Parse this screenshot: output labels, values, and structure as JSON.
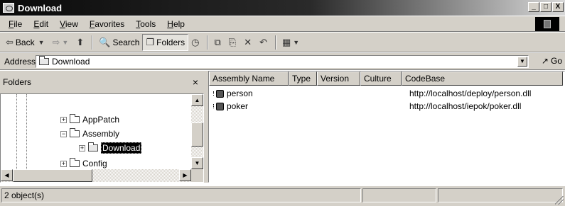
{
  "window": {
    "title": "Download",
    "buttons": [
      "_",
      "□",
      "X"
    ]
  },
  "menu": [
    "File",
    "Edit",
    "View",
    "Favorites",
    "Tools",
    "Help"
  ],
  "toolbar": {
    "back": "Back",
    "search": "Search",
    "folders": "Folders"
  },
  "address": {
    "label": "Address",
    "value": "Download",
    "go": "Go"
  },
  "folders_pane": {
    "header": "Folders",
    "close": "×",
    "tree": [
      {
        "label": "AppPatch",
        "expander": "+",
        "selected": false
      },
      {
        "label": "Assembly",
        "expander": "−",
        "selected": false
      },
      {
        "label": "Download",
        "expander": "+",
        "selected": true
      },
      {
        "label": "Config",
        "expander": "+",
        "selected": false
      }
    ]
  },
  "list": {
    "columns": [
      "Assembly Name",
      "Type",
      "Version",
      "Culture",
      "CodeBase"
    ],
    "rows": [
      {
        "name": "person",
        "type": "",
        "version": "",
        "culture": "",
        "codebase": "http://localhost/deploy/person.dll"
      },
      {
        "name": "poker",
        "type": "",
        "version": "",
        "culture": "",
        "codebase": "http://localhost/iepok/poker.dll"
      }
    ]
  },
  "status": {
    "objects": "2 object(s)"
  }
}
